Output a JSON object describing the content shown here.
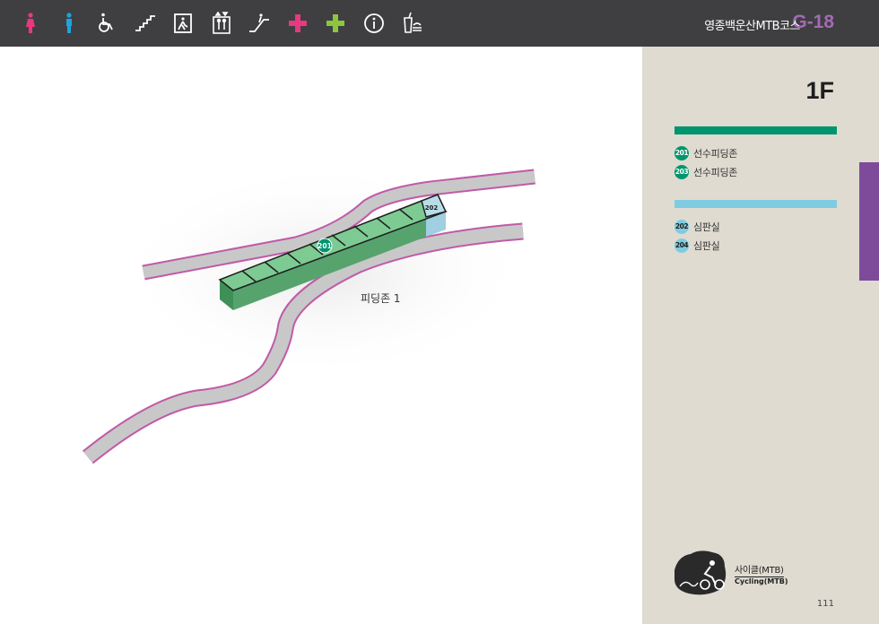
{
  "header": {
    "title": "영종백운산MTB코스",
    "code": "G-18",
    "icons": [
      {
        "name": "female-restroom-icon",
        "color": "#e8387f"
      },
      {
        "name": "male-restroom-icon",
        "color": "#1ca4de"
      },
      {
        "name": "wheelchair-icon",
        "color": "#ffffff"
      },
      {
        "name": "stairs-icon",
        "color": "#ffffff"
      },
      {
        "name": "emergency-exit-icon",
        "color": "#ffffff"
      },
      {
        "name": "elevator-icon",
        "color": "#ffffff"
      },
      {
        "name": "escalator-icon",
        "color": "#ffffff"
      },
      {
        "name": "first-aid-icon",
        "color": "#e8387f"
      },
      {
        "name": "medical-icon",
        "color": "#8cc63f"
      },
      {
        "name": "information-icon",
        "color": "#ffffff"
      },
      {
        "name": "food-drink-icon",
        "color": "#ffffff"
      }
    ]
  },
  "map": {
    "zone_label": "피딩존 1",
    "badges": {
      "a": "201",
      "b": "202"
    },
    "colors": {
      "road": "#c8c8c8",
      "road_edge": "#c05aa8",
      "building": "#5fb07a",
      "building_top": "#7dcb92",
      "accent": "#b7dde8"
    }
  },
  "sidebar": {
    "floor": "1F",
    "groups": [
      {
        "color": "#00956d",
        "items": [
          {
            "num": "201",
            "label": "선수피딩존"
          },
          {
            "num": "203",
            "label": "선수피딩존"
          }
        ]
      },
      {
        "color": "#7fcce1",
        "items": [
          {
            "num": "202",
            "label": "심판실"
          },
          {
            "num": "204",
            "label": "심판실"
          }
        ]
      }
    ],
    "sport": {
      "ko": "사이클(MTB)",
      "en": "Cycling(MTB)"
    },
    "page_number": "111"
  }
}
